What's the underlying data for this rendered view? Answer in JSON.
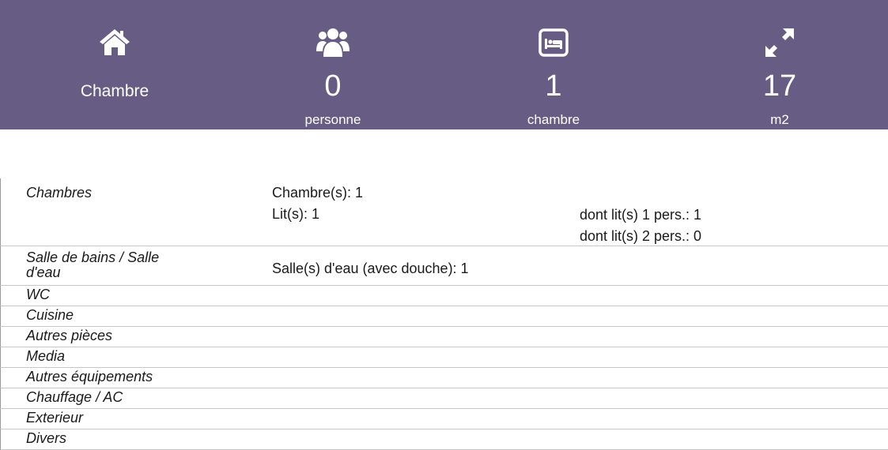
{
  "header": {
    "type": {
      "icon": "home-icon",
      "label": "Chambre"
    },
    "persons": {
      "icon": "users-icon",
      "value": "0",
      "unit": "personne"
    },
    "rooms": {
      "icon": "bed-icon",
      "value": "1",
      "unit": "chambre"
    },
    "area": {
      "icon": "expand-icon",
      "value": "17",
      "unit": "m2"
    }
  },
  "table": {
    "chambres": {
      "label": "Chambres",
      "chambres_count": "Chambre(s): 1",
      "lits": "Lit(s):  1",
      "lits_1pers": "dont lit(s) 1 pers.: 1",
      "lits_2pers": "dont lit(s) 2 pers.: 0"
    },
    "salle_de_bains": {
      "label_line1": "Salle de bains / Salle",
      "label_line2": "d'eau",
      "detail": "Salle(s) d'eau (avec douche):  1"
    },
    "wc": {
      "label": "WC"
    },
    "cuisine": {
      "label": "Cuisine"
    },
    "autres_pieces": {
      "label": "Autres pièces"
    },
    "media": {
      "label": "Media"
    },
    "autres_equipements": {
      "label": "Autres équipements"
    },
    "chauffage": {
      "label": "Chauffage / AC"
    },
    "exterieur": {
      "label": "Exterieur"
    },
    "divers": {
      "label": "Divers"
    }
  }
}
